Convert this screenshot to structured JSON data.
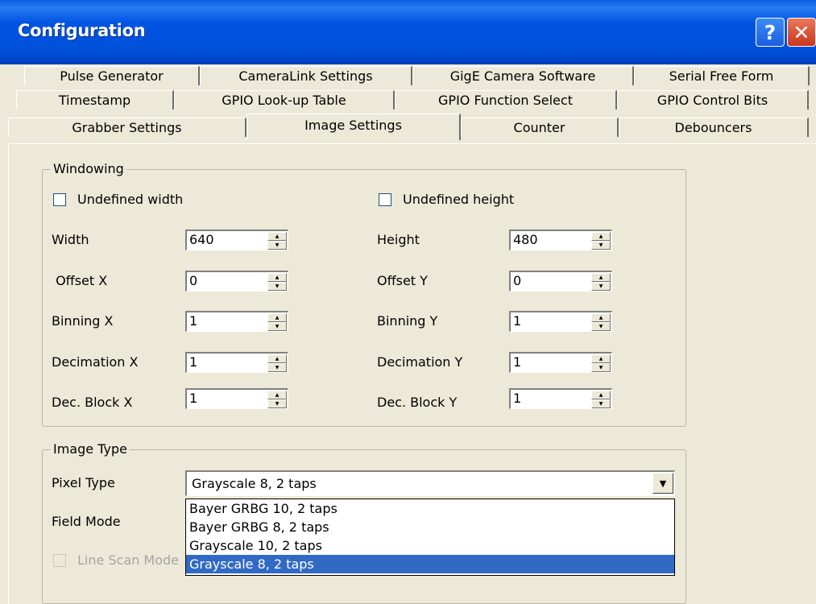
{
  "window": {
    "title": "Configuration",
    "help_label": "?",
    "close_label": "✕"
  },
  "tabs": {
    "row1": [
      "Pulse Generator",
      "CameraLink Settings",
      "GigE Camera Software",
      "Serial Free Form"
    ],
    "row2": [
      "Timestamp",
      "GPIO Look-up Table",
      "GPIO Function Select",
      "GPIO Control Bits"
    ],
    "row3": [
      "Grabber Settings",
      "Image Settings",
      "Counter",
      "Debouncers"
    ],
    "active": "Image Settings"
  },
  "windowing": {
    "title": "Windowing",
    "undefined_width": {
      "label": "Undefined width",
      "checked": false
    },
    "undefined_height": {
      "label": "Undefined height",
      "checked": false
    },
    "left": [
      {
        "label": "Width",
        "value": "640"
      },
      {
        "label": " Offset X",
        "value": "0"
      },
      {
        "label": "Binning X",
        "value": "1"
      },
      {
        "label": "Decimation X",
        "value": "1"
      },
      {
        "label": "Dec. Block X",
        "value": "1"
      }
    ],
    "right": [
      {
        "label": "Height",
        "value": "480"
      },
      {
        "label": "Offset Y",
        "value": "0"
      },
      {
        "label": "Binning Y",
        "value": "1"
      },
      {
        "label": "Decimation Y",
        "value": "1"
      },
      {
        "label": "Dec. Block Y",
        "value": "1"
      }
    ]
  },
  "image_type": {
    "title": "Image Type",
    "pixel_type_label": "Pixel Type",
    "pixel_type_value": "Grayscale 8, 2 taps",
    "field_mode_label": "Field Mode",
    "line_scan_label": "Line Scan Mode",
    "options": [
      "Bayer GRBG 10, 2 taps",
      "Bayer GRBG 8, 2 taps",
      "Grayscale 10, 2 taps",
      "Grayscale 8, 2 taps"
    ],
    "selected_option": "Grayscale 8, 2 taps"
  },
  "icons": {
    "spin_up": "spin-up-arrow-icon",
    "spin_down": "spin-down-arrow-icon",
    "dropdown": "dropdown-arrow-icon"
  },
  "colors": {
    "title_bar": "#0054e3",
    "dialog_bg": "#ece9d8",
    "selection": "#316ac5",
    "close_button": "#c8361c"
  }
}
